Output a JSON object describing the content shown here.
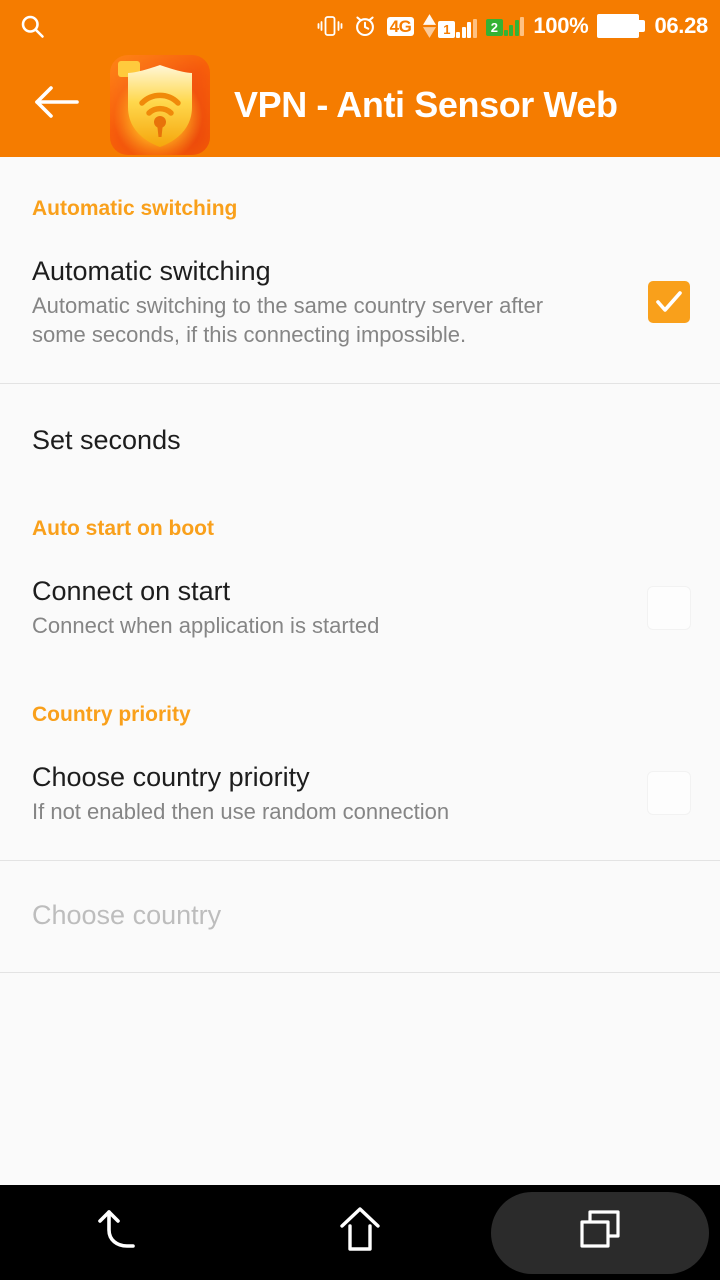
{
  "status_bar": {
    "search_icon": "search-icon",
    "vibrate_icon": "vibrate-icon",
    "alarm_icon": "alarm-clock-icon",
    "network_type": "4G",
    "sim1_label": "1",
    "sim2_label": "2",
    "battery_percent": "100%",
    "time": "06.28",
    "colors": {
      "background": "#F57C00",
      "sim2_green": "#35b234"
    }
  },
  "app_bar": {
    "back_icon": "back-arrow-icon",
    "app_icon": "vpn-shield-icon",
    "title": "VPN - Anti Sensor Web",
    "colors": {
      "background": "#F57C00",
      "title": "#ffffff"
    }
  },
  "settings": {
    "sections": [
      {
        "header": "Automatic switching",
        "rows": [
          {
            "title": "Automatic switching",
            "subtitle": "Automatic switching to the same country server after some seconds, if this connecting impossible.",
            "checkbox": "checked",
            "disabled": false
          }
        ]
      },
      {
        "header": "",
        "rows": [
          {
            "title": "Set seconds",
            "subtitle": "",
            "checkbox": "none",
            "disabled": false
          }
        ]
      },
      {
        "header": "Auto start on boot",
        "rows": [
          {
            "title": "Connect on start",
            "subtitle": "Connect when application is started",
            "checkbox": "unchecked",
            "disabled": false
          }
        ]
      },
      {
        "header": "Country priority",
        "rows": [
          {
            "title": "Choose country priority",
            "subtitle": "If not enabled then use random connection",
            "checkbox": "unchecked",
            "disabled": false
          },
          {
            "title": "Choose country",
            "subtitle": "",
            "checkbox": "none",
            "disabled": true
          }
        ]
      }
    ],
    "colors": {
      "section_header": "#F9A01B",
      "title": "#1d1d1d",
      "subtitle": "#858585",
      "disabled_title": "#bdbdbd",
      "checkbox_checked": "#F9A01B",
      "divider": "#e3e3e3",
      "background": "#fafafa"
    }
  },
  "nav_bar": {
    "back": "back-icon",
    "home": "home-icon",
    "recents": "recents-icon",
    "recents_highlighted": true,
    "colors": {
      "background": "#000000",
      "pill": "#2b2b2b"
    }
  }
}
